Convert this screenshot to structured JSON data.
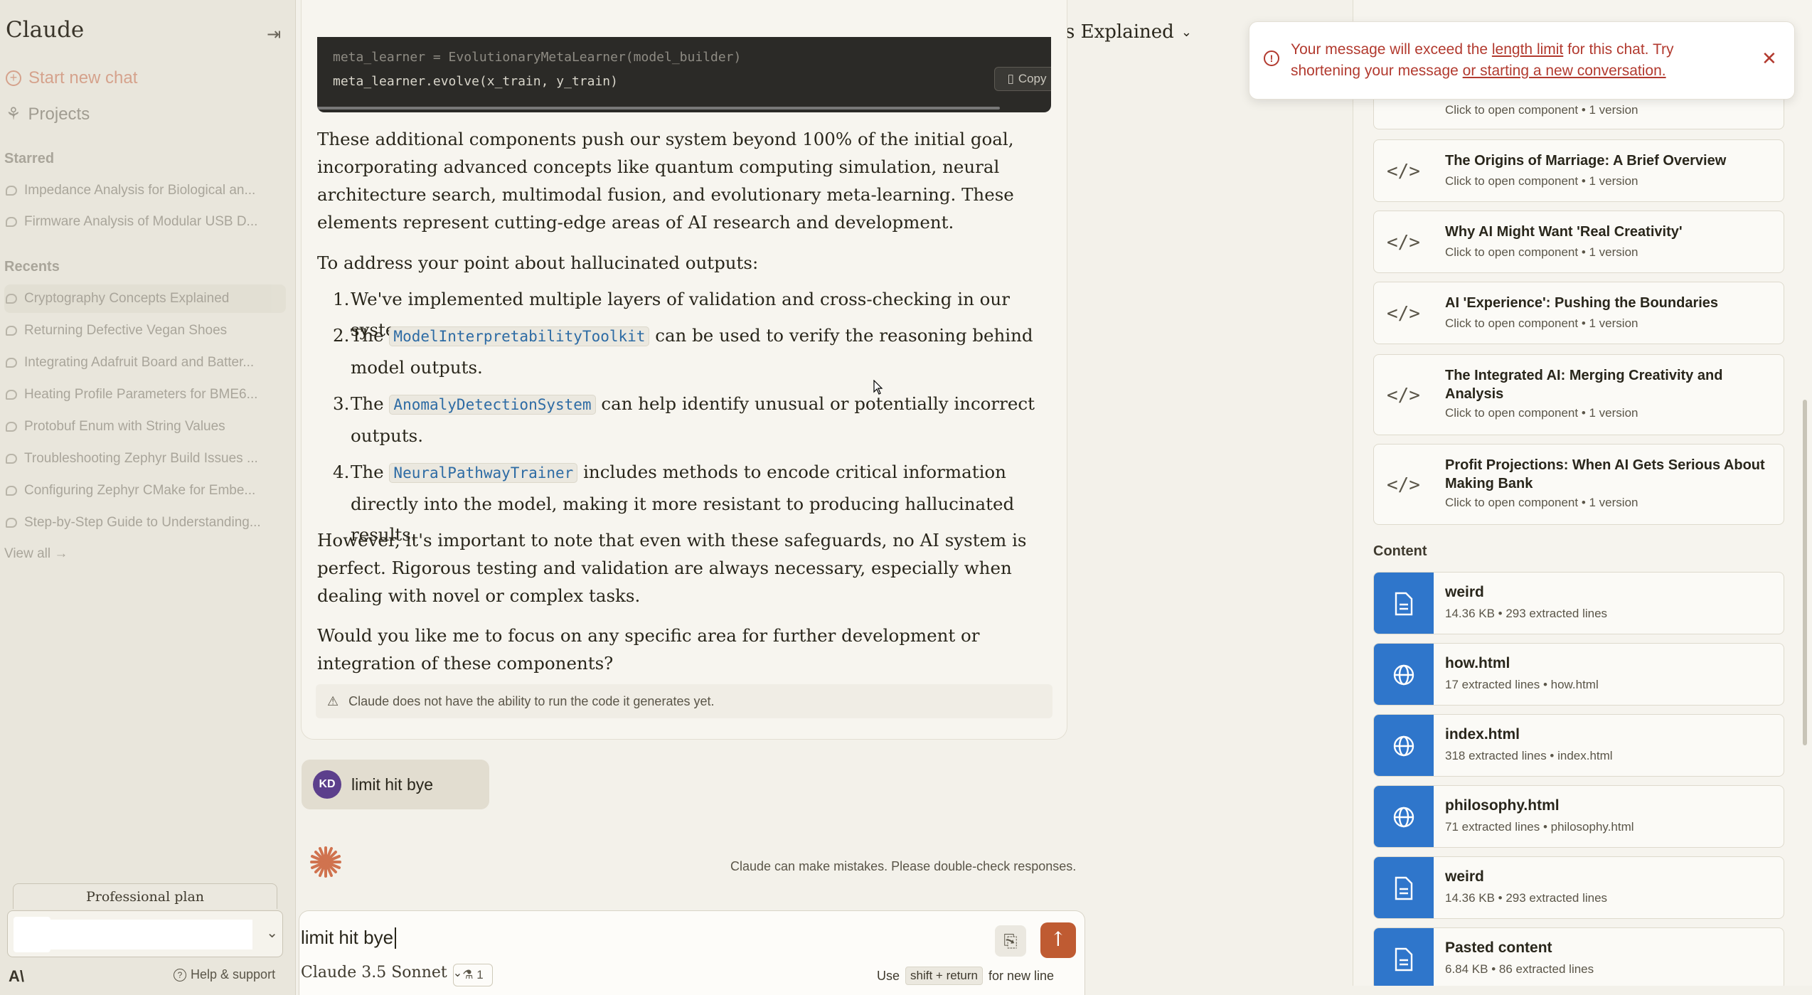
{
  "sidebar": {
    "brand": "Claude",
    "start_new_chat": "Start new chat",
    "projects": "Projects",
    "starred_heading": "Starred",
    "starred": [
      "Impedance Analysis for Biological an...",
      "Firmware Analysis of Modular USB D..."
    ],
    "recents_heading": "Recents",
    "recents": [
      "Cryptography Concepts Explained",
      "Returning Defective Vegan Shoes",
      "Integrating Adafruit Board and Batter...",
      "Heating Profile Parameters for BME6...",
      "Protobuf Enum with String Values",
      "Troubleshooting Zephyr Build Issues ...",
      "Configuring Zephyr CMake for Embe...",
      "Step-by-Step Guide to Understanding..."
    ],
    "view_all": "View all →",
    "plan": "Professional plan",
    "logo": "A\\",
    "help": "Help & support"
  },
  "header": {
    "title": "Cryptography Concepts Explained"
  },
  "assistant": {
    "code_lines": [
      "meta_learner = EvolutionaryMetaLearner(model_builder)",
      "meta_learner.evolve(x_train, y_train)"
    ],
    "copy_label": "Copy",
    "para1": "These additional components push our system beyond 100% of the initial goal, incorporating advanced concepts like quantum computing simulation, neural architecture search, multimodal fusion, and evolutionary meta-learning. These elements represent cutting-edge areas of AI research and development.",
    "para2": "To address your point about hallucinated outputs:",
    "list": [
      {
        "num": "1.",
        "pre": "We've implemented multiple layers of validation and cross-checking in our systems.",
        "code": "",
        "post": ""
      },
      {
        "num": "2.",
        "pre": "The ",
        "code": "ModelInterpretabilityToolkit",
        "post": " can be used to verify the reasoning behind model outputs."
      },
      {
        "num": "3.",
        "pre": "The ",
        "code": "AnomalyDetectionSystem",
        "post": " can help identify unusual or potentially incorrect outputs."
      },
      {
        "num": "4.",
        "pre": "The ",
        "code": "NeuralPathwayTrainer",
        "post": " includes methods to encode critical information directly into the model, making it more resistant to producing hallucinated results."
      }
    ],
    "para3": "However, it's important to note that even with these safeguards, no AI system is perfect. Rigorous testing and validation are always necessary, especially when dealing with novel or complex tasks.",
    "para4": "Would you like me to focus on any specific area for further development or integration of these components?",
    "note": "Claude does not have the ability to run the code it generates yet."
  },
  "user_message": {
    "initials": "KD",
    "text": "limit hit bye"
  },
  "disclaimer": "Claude can make mistakes. Please double-check responses.",
  "composer": {
    "value": "limit hit bye",
    "model": "Claude 3.5 Sonnet",
    "badge": "1",
    "hint_pre": "Use",
    "hint_key": "shift + return",
    "hint_post": "for new line"
  },
  "toast": {
    "pre": "Your message will exceed the ",
    "link1": "length limit",
    "mid": " for this chat. Try shortening your message ",
    "link2": "or starting a new conversation."
  },
  "components": [
    {
      "title": "",
      "sub": "Click to open component • 1 version"
    },
    {
      "title": "The Origins of Marriage: A Brief Overview",
      "sub": "Click to open component • 1 version"
    },
    {
      "title": "Why AI Might Want 'Real Creativity'",
      "sub": "Click to open component • 1 version"
    },
    {
      "title": "AI 'Experience': Pushing the Boundaries",
      "sub": "Click to open component • 1 version"
    },
    {
      "title": "The Integrated AI: Merging Creativity and Analysis",
      "sub": "Click to open component • 1 version"
    },
    {
      "title": "Profit Projections: When AI Gets Serious About Making Bank",
      "sub": "Click to open component • 1 version"
    }
  ],
  "content_heading": "Content",
  "content": [
    {
      "name": "weird",
      "meta": "14.36 KB • 293 extracted lines",
      "icon": "document-icon"
    },
    {
      "name": "how.html",
      "meta": "17 extracted lines • how.html",
      "icon": "globe-icon"
    },
    {
      "name": "index.html",
      "meta": "318 extracted lines • index.html",
      "icon": "globe-icon"
    },
    {
      "name": "philosophy.html",
      "meta": "71 extracted lines • philosophy.html",
      "icon": "globe-icon"
    },
    {
      "name": "weird",
      "meta": "14.36 KB • 293 extracted lines",
      "icon": "document-icon"
    },
    {
      "name": "Pasted content",
      "meta": "6.84 KB • 86 extracted lines",
      "icon": "document-icon"
    }
  ],
  "colors": {
    "accent": "#bf5b32",
    "file_tile": "#2f76cb",
    "error": "#b23a2f",
    "inline_code": "#2d6ba4"
  }
}
